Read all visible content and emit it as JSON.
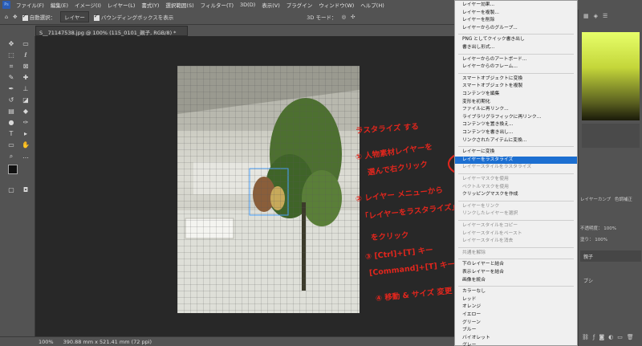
{
  "app": {
    "logo_text": "Ps"
  },
  "menubar": {
    "items": [
      "ファイル(F)",
      "編集(E)",
      "イメージ(I)",
      "レイヤー(L)",
      "書式(Y)",
      "選択範囲(S)",
      "フィルター(T)",
      "3D(D)",
      "表示(V)",
      "プラグイン",
      "ウィンドウ(W)",
      "ヘルプ(H)"
    ]
  },
  "options": {
    "auto_select_label": "自動選択：",
    "layer_select_value": "レイヤー",
    "bbox_label": "バウンディングボックスを表示",
    "mode_label": "3D モード："
  },
  "document": {
    "tab_title": "S__71147538.jpg @ 100% (115_0101_親子, RGB/8) *"
  },
  "status": {
    "zoom": "100%",
    "dimensions": "390.88 mm x 521.41 mm (72 ppi)"
  },
  "right_panel": {
    "tab_a": "レイヤーカンプ",
    "tab_b": "色調補正",
    "mode_label": "不透明度：",
    "mode_value": "100%",
    "fill_label": "塗り：",
    "fill_value": "100%",
    "layer1": "親子",
    "layer2": "ブシ"
  },
  "menu": {
    "items": [
      {
        "label": "レイヤー効果...",
        "state": "normal"
      },
      {
        "label": "レイヤーを複製...",
        "state": "normal"
      },
      {
        "label": "レイヤーを削除",
        "state": "normal"
      },
      {
        "label": "レイヤーからのグループ...",
        "state": "normal"
      },
      {
        "label": "PNG としてクイック書き出し",
        "state": "normal"
      },
      {
        "label": "書き出し形式...",
        "state": "normal"
      },
      {
        "label": "レイヤーからのアートボード...",
        "state": "normal"
      },
      {
        "label": "レイヤーからのフレーム...",
        "state": "normal"
      },
      {
        "label": "スマートオブジェクトに変換",
        "state": "normal"
      },
      {
        "label": "スマートオブジェクトを複製",
        "state": "normal"
      },
      {
        "label": "コンテンツを編集",
        "state": "normal"
      },
      {
        "label": "変形を初期化",
        "state": "normal"
      },
      {
        "label": "ファイルに再リンク...",
        "state": "normal"
      },
      {
        "label": "ライブラリグラフィックに再リンク...",
        "state": "normal"
      },
      {
        "label": "コンテンツを置き換え...",
        "state": "normal"
      },
      {
        "label": "コンテンツを書き出し...",
        "state": "normal"
      },
      {
        "label": "リンクされたアイテムに変換...",
        "state": "normal"
      },
      {
        "label": "レイヤーに変換",
        "state": "normal"
      },
      {
        "label": "レイヤーをラスタライズ",
        "state": "highlight"
      },
      {
        "label": "レイヤースタイルをラスタライズ",
        "state": "disabled"
      },
      {
        "label": "レイヤーマスクを使用",
        "state": "disabled"
      },
      {
        "label": "ベクトルマスクを使用",
        "state": "disabled"
      },
      {
        "label": "クリッピングマスクを作成",
        "state": "normal"
      },
      {
        "label": "レイヤーをリンク",
        "state": "disabled"
      },
      {
        "label": "リンクしたレイヤーを選択",
        "state": "disabled"
      },
      {
        "label": "レイヤースタイルをコピー",
        "state": "disabled"
      },
      {
        "label": "レイヤースタイルをペースト",
        "state": "disabled"
      },
      {
        "label": "レイヤースタイルを消去",
        "state": "disabled"
      },
      {
        "label": "共通を解除",
        "state": "disabled"
      },
      {
        "label": "下のレイヤーと結合",
        "state": "normal"
      },
      {
        "label": "表示レイヤーを結合",
        "state": "normal"
      },
      {
        "label": "画像を統合",
        "state": "normal"
      },
      {
        "label": "カラーなし",
        "state": "normal"
      },
      {
        "label": "レッド",
        "state": "normal"
      },
      {
        "label": "オレンジ",
        "state": "normal"
      },
      {
        "label": "イエロー",
        "state": "normal"
      },
      {
        "label": "グリーン",
        "state": "normal"
      },
      {
        "label": "ブルー",
        "state": "normal"
      },
      {
        "label": "バイオレット",
        "state": "normal"
      },
      {
        "label": "グレー",
        "state": "normal"
      }
    ]
  },
  "annotation": {
    "title": "ラスタライズ する",
    "step1a": "① 人物素材レイヤーを",
    "step1b": "選んで右クリック",
    "step2a": "② レイヤー メニューから",
    "step2b": "「レイヤーをラスタライズ」",
    "step2c": "をクリック",
    "step3a": "③ [Ctrl]+[T] キー",
    "step3b": "[Command]+[T] キーで",
    "step4": "④ 移動 & サイズ 変更"
  },
  "colors": {
    "accent": "#1c6fd1",
    "annotation": "#e2261d"
  }
}
